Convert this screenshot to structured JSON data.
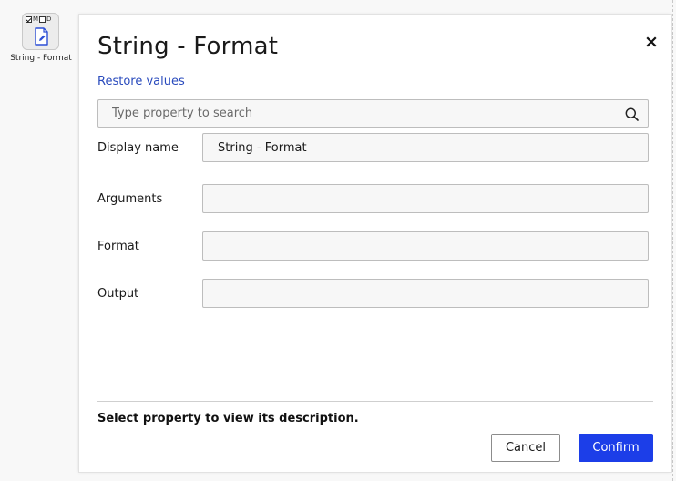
{
  "canvas": {
    "node": {
      "flag_m": "M",
      "flag_d": "D",
      "flag_m_checked": true,
      "flag_d_checked": false,
      "icon": "document-edit-icon",
      "label": "String - Format"
    }
  },
  "dialog": {
    "title": "String - Format",
    "close_icon": "close-icon",
    "restore_label": "Restore values",
    "search": {
      "placeholder": "Type property to search",
      "value": "",
      "icon": "search-icon"
    },
    "display_name": {
      "label": "Display name",
      "value": "String - Format"
    },
    "properties": [
      {
        "label": "Arguments",
        "value": ""
      },
      {
        "label": "Format",
        "value": ""
      },
      {
        "label": "Output",
        "value": ""
      }
    ],
    "description_hint": "Select property to view its description.",
    "cancel_label": "Cancel",
    "confirm_label": "Confirm"
  },
  "colors": {
    "accent": "#1c3ee8",
    "link": "#2a4bbd",
    "field_bg": "#f7f7f7",
    "field_border": "#bdbdbd"
  }
}
